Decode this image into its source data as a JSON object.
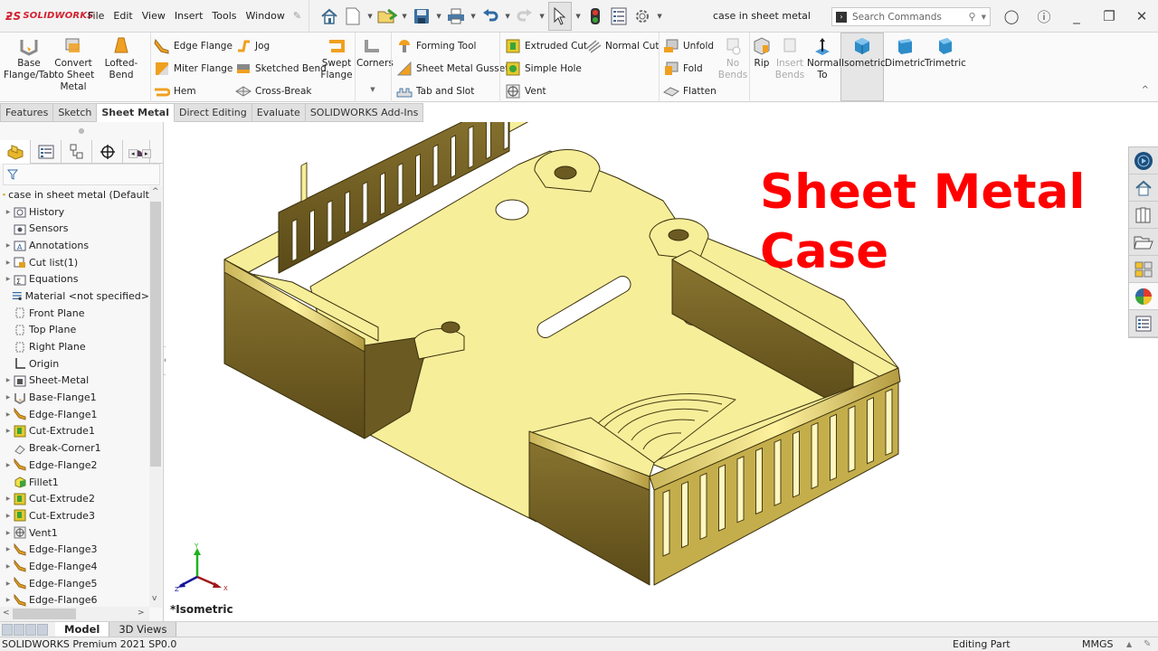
{
  "app": {
    "brand": "SOLIDWORKS",
    "document_title": "case in sheet metal",
    "search_placeholder": "Search Commands"
  },
  "menu": [
    "File",
    "Edit",
    "View",
    "Insert",
    "Tools",
    "Window"
  ],
  "quick_access": [
    "home-icon",
    "new-document-icon",
    "open-icon",
    "save-icon",
    "print-icon",
    "undo-icon",
    "redo-icon",
    "select-icon",
    "rebuild-icon",
    "file-properties-icon",
    "options-icon"
  ],
  "ribbon": {
    "base_flange": "Base\nFlange/Tab",
    "convert": "Convert\nto Sheet\nMetal",
    "lofted_bend": "Lofted-Bend",
    "edge_flange": "Edge Flange",
    "miter_flange": "Miter Flange",
    "hem": "Hem",
    "jog": "Jog",
    "sketched_bend": "Sketched Bend",
    "cross_break": "Cross-Break",
    "swept_flange": "Swept\nFlange",
    "corners": "Corners",
    "forming_tool": "Forming Tool",
    "gusset": "Sheet Metal Gusset",
    "tab_slot": "Tab and Slot",
    "extruded_cut": "Extruded Cut",
    "simple_hole": "Simple Hole",
    "vent": "Vent",
    "normal_cut": "Normal Cut",
    "unfold": "Unfold",
    "fold": "Fold",
    "flatten": "Flatten",
    "no_bends": "No\nBends",
    "rip": "Rip",
    "insert_bends": "Insert\nBends",
    "normal_to": "Normal\nTo",
    "isometric": "Isometric",
    "dimetric": "Dimetric",
    "trimetric": "Trimetric"
  },
  "command_tabs": [
    {
      "label": "Features",
      "active": false
    },
    {
      "label": "Sketch",
      "active": false
    },
    {
      "label": "Sheet Metal",
      "active": true
    },
    {
      "label": "Direct Editing",
      "active": false
    },
    {
      "label": "Evaluate",
      "active": false
    },
    {
      "label": "SOLIDWORKS Add-Ins",
      "active": false
    }
  ],
  "feature_tree": {
    "root": "case in sheet metal  (Default",
    "items": [
      {
        "label": "History",
        "expandable": true,
        "icon": "history-folder-icon"
      },
      {
        "label": "Sensors",
        "expandable": false,
        "icon": "sensors-folder-icon"
      },
      {
        "label": "Annotations",
        "expandable": true,
        "icon": "annotations-folder-icon"
      },
      {
        "label": "Cut list(1)",
        "expandable": true,
        "icon": "cut-list-icon"
      },
      {
        "label": "Equations",
        "expandable": true,
        "icon": "equations-folder-icon"
      },
      {
        "label": "Material <not specified>",
        "expandable": false,
        "icon": "material-icon"
      },
      {
        "label": "Front Plane",
        "expandable": false,
        "icon": "plane-icon"
      },
      {
        "label": "Top Plane",
        "expandable": false,
        "icon": "plane-icon"
      },
      {
        "label": "Right Plane",
        "expandable": false,
        "icon": "plane-icon"
      },
      {
        "label": "Origin",
        "expandable": false,
        "icon": "origin-icon"
      },
      {
        "label": "Sheet-Metal",
        "expandable": true,
        "icon": "sheet-metal-folder-icon"
      },
      {
        "label": "Base-Flange1",
        "expandable": true,
        "icon": "base-flange-icon"
      },
      {
        "label": "Edge-Flange1",
        "expandable": true,
        "icon": "edge-flange-icon"
      },
      {
        "label": "Cut-Extrude1",
        "expandable": true,
        "icon": "cut-extrude-icon"
      },
      {
        "label": "Break-Corner1",
        "expandable": false,
        "icon": "break-corner-icon"
      },
      {
        "label": "Edge-Flange2",
        "expandable": true,
        "icon": "edge-flange-icon"
      },
      {
        "label": "Fillet1",
        "expandable": false,
        "icon": "fillet-icon"
      },
      {
        "label": "Cut-Extrude2",
        "expandable": true,
        "icon": "cut-extrude-icon"
      },
      {
        "label": "Cut-Extrude3",
        "expandable": true,
        "icon": "cut-extrude-icon"
      },
      {
        "label": "Vent1",
        "expandable": true,
        "icon": "vent-icon"
      },
      {
        "label": "Edge-Flange3",
        "expandable": true,
        "icon": "edge-flange-icon"
      },
      {
        "label": "Edge-Flange4",
        "expandable": true,
        "icon": "edge-flange-icon"
      },
      {
        "label": "Edge-Flange5",
        "expandable": true,
        "icon": "edge-flange-icon"
      },
      {
        "label": "Edge-Flange6",
        "expandable": true,
        "icon": "edge-flange-icon"
      }
    ]
  },
  "viewport": {
    "headline_line1": "Sheet Metal",
    "headline_line2": "Case",
    "orientation_label": "*Isometric",
    "triad": {
      "x": "X",
      "y": "Y",
      "z": "Z"
    },
    "colors": {
      "headline": "#ff0000",
      "part_face": "#f7ee9a",
      "part_side": "#6b5a22"
    }
  },
  "bottom_tabs": [
    {
      "label": "Model",
      "active": true
    },
    {
      "label": "3D Views",
      "active": false
    }
  ],
  "status_bar": {
    "version": "SOLIDWORKS Premium 2021 SP0.0",
    "mode": "Editing Part",
    "units": "MMGS"
  }
}
